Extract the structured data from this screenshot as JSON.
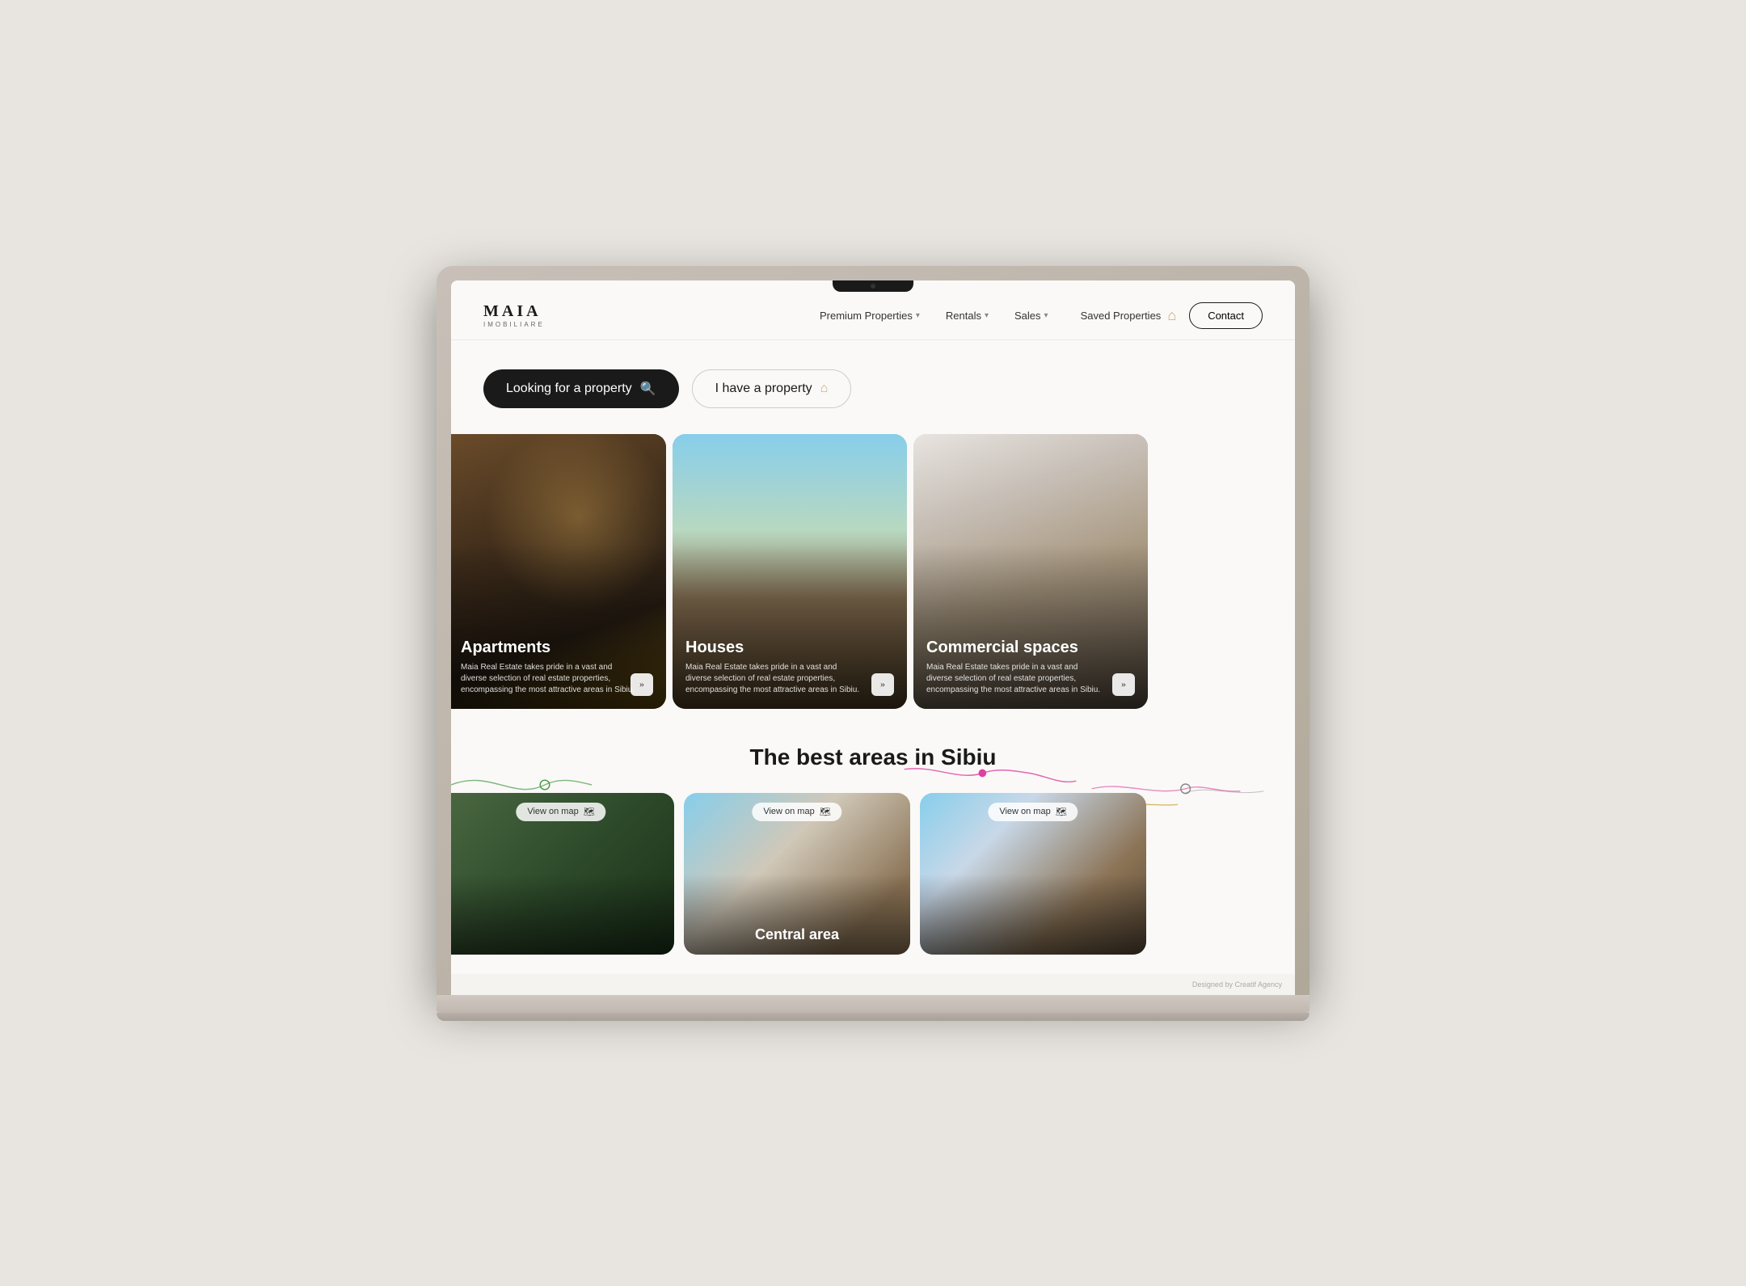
{
  "brand": {
    "name": "MAIA",
    "subtitle": "IMOBILIARE"
  },
  "nav": {
    "links": [
      {
        "label": "Premium Properties",
        "has_dropdown": true
      },
      {
        "label": "Rentals",
        "has_dropdown": true
      },
      {
        "label": "Sales",
        "has_dropdown": true
      }
    ],
    "saved_properties": "Saved Properties",
    "contact": "Contact"
  },
  "hero": {
    "btn_looking": "Looking for a property",
    "btn_have": "I have a property"
  },
  "property_cards": [
    {
      "title": "Apartments",
      "description": "Maia Real Estate takes pride in a vast and diverse selection of real estate properties, encompassing the most attractive areas in Sibiu.",
      "type": "apartments"
    },
    {
      "title": "Houses",
      "description": "Maia Real Estate takes pride in a vast and diverse selection of real estate properties, encompassing the most attractive areas in Sibiu.",
      "type": "houses"
    },
    {
      "title": "Commercial spaces",
      "description": "Maia Real Estate takes pride in a vast and diverse selection of real estate properties, encompassing the most attractive areas in Sibiu.",
      "type": "commercial"
    }
  ],
  "areas": {
    "title": "The best areas in Sibiu",
    "cards": [
      {
        "title": "",
        "view_map": "View on map",
        "type": "forest"
      },
      {
        "title": "Central area",
        "view_map": "View on map",
        "type": "central"
      },
      {
        "title": "",
        "view_map": "View on map",
        "type": "modern"
      }
    ]
  },
  "footer": {
    "credit": "Designed by Creatif Agency"
  }
}
